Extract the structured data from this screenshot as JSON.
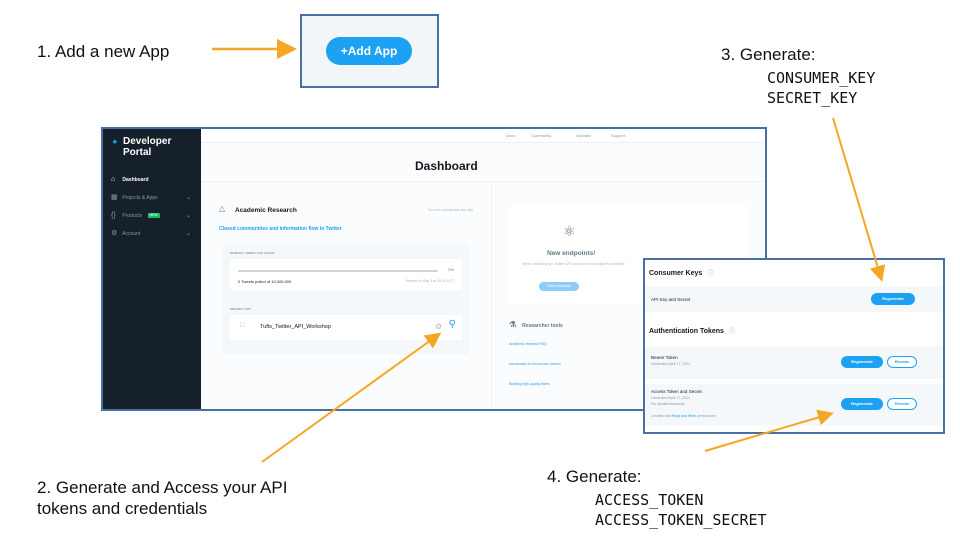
{
  "steps": {
    "s1": "1. Add a new App",
    "s2_line1": "2. Generate and Access your API",
    "s2_line2": "tokens and credentials",
    "s3": "3. Generate:",
    "s3_code1": "CONSUMER_KEY",
    "s3_code2": "SECRET_KEY",
    "s4": "4. Generate:",
    "s4_code1": "ACCESS_TOKEN",
    "s4_code2": "ACCESS_TOKEN_SECRET"
  },
  "add_app_label": "+Add App",
  "sidebar": {
    "title": "Developer Portal",
    "items": [
      {
        "label": "Dashboard",
        "icon": "home-icon"
      },
      {
        "label": "Projects & Apps",
        "icon": "projects-icon"
      },
      {
        "label": "Products",
        "badge": "NEW",
        "icon": "code-icon"
      },
      {
        "label": "Account",
        "icon": "gear-icon"
      }
    ]
  },
  "topnav": [
    "Docs",
    "Community",
    "Updates",
    "Support"
  ],
  "dashboard": {
    "title": "Dashboard",
    "research": {
      "heading": "Academic Research",
      "note": "For non-commercial use only",
      "project_name": "Closed communities and information flow in Twitter",
      "usage_label": "MONTHLY TWEET CAP USAGE",
      "usage_percent_label": "0%",
      "usage_fraction": 0.0,
      "usage_text": "0 Tweets pulled of 10,000,000",
      "usage_reset": "Resets on May 3 at 00:00 UTC",
      "project_app_label": "PROJECT APP",
      "app_name": "Tufts_Twitter_API_Workshop"
    },
    "new_endpoints": {
      "title": "New endpoints!",
      "text": "We're rebuilding the Twitter API and have new endpoints available.",
      "button": "View endpoints"
    },
    "researcher_tools": {
      "title": "Researcher tools",
      "links": [
        "Academic research FAQ",
        "Introduction to full-archive search",
        "Building high-quality filters"
      ]
    }
  },
  "keys": {
    "consumer_heading": "Consumer Keys",
    "api_key_label": "API Key and Secret",
    "auth_heading": "Authentication Tokens",
    "bearer_label": "Bearer Token",
    "bearer_sub": "Generated April 17, 2021",
    "access_label": "Access Token and Secret",
    "access_sub1": "Generated April 17, 2021",
    "access_sub2": "For @tuftsresearchlip",
    "access_perm_prefix": "Created with ",
    "access_perm_value": "Read and Write",
    "access_perm_suffix": " permissions",
    "regenerate": "Regenerate",
    "revoke": "Revoke"
  },
  "colors": {
    "arrow": "#f5a623",
    "frame": "#4a6fa5",
    "accent": "#1da1f2",
    "sidebar_bg": "#15202b"
  }
}
